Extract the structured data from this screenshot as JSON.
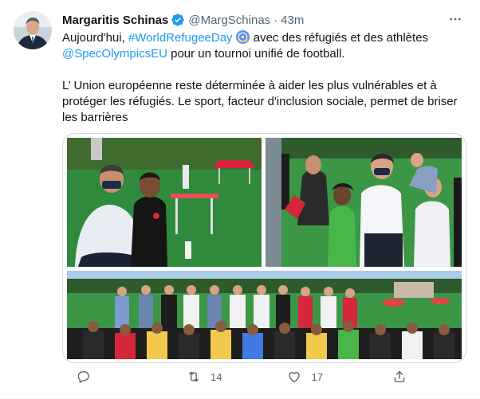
{
  "author": {
    "name": "Margaritis Schinas",
    "handle": "@MargSchinas",
    "separator": "·",
    "time": "43m"
  },
  "text": {
    "line1_start": "Aujourd'hui, ",
    "hashtag": "#WorldRefugeeDay",
    "line1_end": " avec des réfugiés et des athlètes",
    "mention": "@SpecOlympicsEU",
    "line2_end": " pour un tournoi unifié de football.",
    "paragraph2": "L’ Union européenne reste déterminée à aider les plus vulnérables et à protéger les réfugiés. Le sport, facteur d'inclusion sociale, permet de briser les barrières"
  },
  "actions": {
    "reply_count": "",
    "retweet_count": "14",
    "like_count": "17"
  },
  "icons": {
    "verified": "verified-badge-icon",
    "more": "more-icon",
    "reply": "reply-icon",
    "retweet": "retweet-icon",
    "like": "heart-icon",
    "share": "share-icon",
    "emoji": "un-emblem-emoji"
  },
  "colors": {
    "link": "#1d9bf0",
    "muted": "#536471",
    "border": "#cfd9de"
  }
}
